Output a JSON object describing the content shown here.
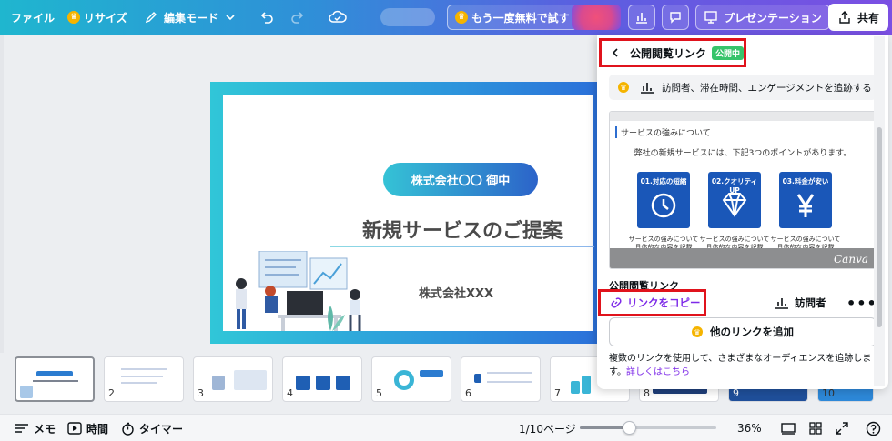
{
  "topbar": {
    "file": "ファイル",
    "resize": "リサイズ",
    "edit_mode": "編集モード",
    "trial": "もう一度無料で試す",
    "present": "プレゼンテーション",
    "share": "共有"
  },
  "slide": {
    "company": "株式会社〇〇 御中",
    "title": "新規サービスのご提案",
    "presenter": "株式会社XXX"
  },
  "thumbnails": [
    "2",
    "3",
    "4",
    "5",
    "6",
    "7",
    "8",
    "9",
    "10"
  ],
  "bottombar": {
    "memo": "メモ",
    "time": "時間",
    "timer": "タイマー",
    "page": "1/10ページ",
    "zoom": "36%",
    "zoom_level": 0.36
  },
  "panel": {
    "title": "公開閲覧リンク",
    "badge": "公開中",
    "track": "訪問者、滞在時間、エンゲージメントを追跡する",
    "preview": {
      "heading": "サービスの強みについて",
      "subtitle": "弊社の新規サービスには、下記3つのポイントがあります。",
      "cards": [
        {
          "label": "01.対応の短縮",
          "desc1": "サービスの強みについて",
          "desc2": "具体的な内容を記載"
        },
        {
          "label": "02.クオリティUP",
          "desc1": "サービスの強みについて",
          "desc2": "具体的な内容を記載"
        },
        {
          "label": "03.料金が安い",
          "desc1": "サービスの強みについて",
          "desc2": "具体的な内容を記載"
        }
      ],
      "brand": "Canva"
    },
    "public_label": "公開閲覧リンク",
    "copy_link": "リンクをコピー",
    "visitors": "訪問者",
    "more": "•••",
    "add_link": "他のリンクを追加",
    "info": "複数のリンクを使用して、さまざまなオーディエンスを追跡します。",
    "info_link": "詳しくはこちら"
  },
  "colors": {
    "accent": "#7d2ae8",
    "highlight": "#e0131c",
    "badge": "#37c46b",
    "card_blue": "#1a57b8"
  }
}
